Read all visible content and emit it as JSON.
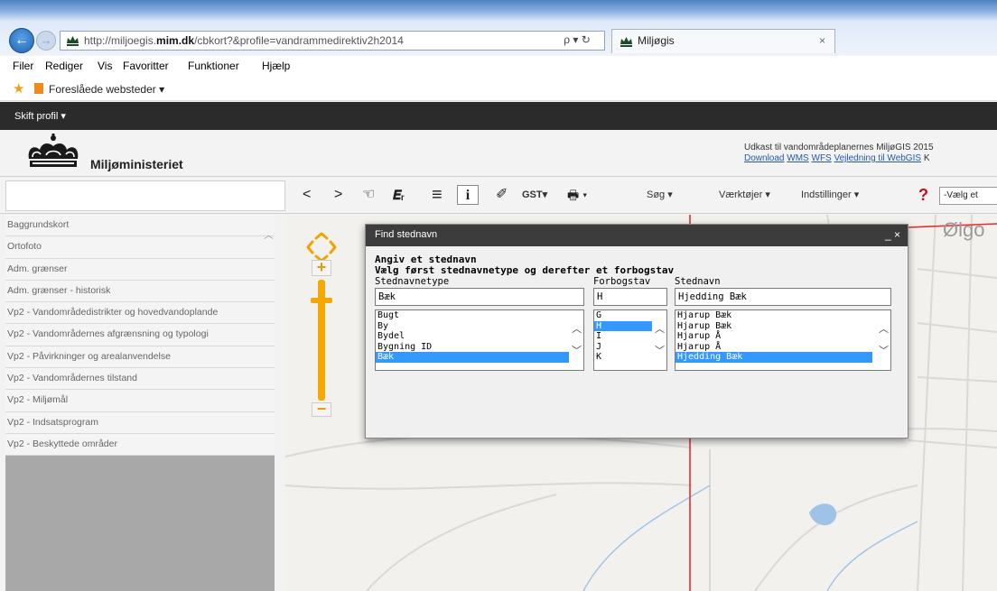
{
  "browser": {
    "url_prefix": "http://miljoegis.",
    "url_host": "mim.dk",
    "url_path": "/cbkort?&profile=vandrammedirektiv2h2014",
    "addr_actions": "ρ ▾ ↻",
    "tab_title": "Miljøgis",
    "tab_close": "×",
    "menu": [
      "Filer",
      "Rediger",
      "Vis",
      "Favoritter",
      "Funktioner",
      "Hjælp"
    ],
    "favorites_label": "Foreslåede websteder ▾"
  },
  "app": {
    "profile_button": "Skift profil ▾",
    "logo_text": "Miljøministeriet",
    "header_info": "Udkast til vandområdeplanernes MiljøGIS 2015",
    "header_links": {
      "download": "Download",
      "wms": "WMS",
      "wfs": "WFS",
      "guide": "Vejledning til WebGIS",
      "trailing": "K"
    },
    "toolbar": {
      "back": "<",
      "forward": ">",
      "pan": "☜",
      "measure": "𝑬ᵣ",
      "list": "≡",
      "info": "i",
      "eraser": "✐",
      "gst": "GST▾",
      "print": "🖶 ▾",
      "search": "Søg ▾",
      "tools": "Værktøjer ▾",
      "settings": "Indstillinger ▾",
      "help": "?",
      "select_placeholder": "-Vælg et"
    },
    "layers": [
      "Baggrundskort",
      "Ortofoto",
      "Adm. grænser",
      "Adm. grænser - historisk",
      "Vp2 - Vandområdedistrikter og hovedvandoplande",
      "Vp2 - Vandområdernes afgrænsning og typologi",
      "Vp2 - Påvirkninger og arealanvendelse",
      "Vp2 - Vandområdernes tilstand",
      "Vp2 - Miljømål",
      "Vp2 - Indsatsprogram",
      "Vp2 - Beskyttede områder"
    ],
    "map_label": "Ølgo"
  },
  "dialog": {
    "title": "Find stednavn",
    "controls": "_ ×",
    "heading": "Angiv et stednavn",
    "subheading": "Vælg først stednavnetype og derefter et forbogstav",
    "col_type_label": "Stednavnetype",
    "col_letter_label": "Forbogstav",
    "col_name_label": "Stednavn",
    "type_value": "Bæk",
    "letter_value": "H",
    "name_value": "Hjedding Bæk",
    "types": [
      "Bugt",
      "By",
      "Bydel",
      "Bygning ID",
      "Bæk"
    ],
    "types_selected": 4,
    "letters": [
      "G",
      "H",
      "I",
      "J",
      "K"
    ],
    "letters_selected": 1,
    "names": [
      "Hjarup Bæk",
      "Hjarup Bæk",
      "Hjarup Å",
      "Hjarup Å",
      "Hjedding Bæk"
    ],
    "names_selected": 4
  },
  "colors": {
    "accent_orange": "#f6a800",
    "selection_blue": "#3399ff",
    "dark_bar": "#2b2b2b",
    "map_red_line": "#e03030"
  }
}
